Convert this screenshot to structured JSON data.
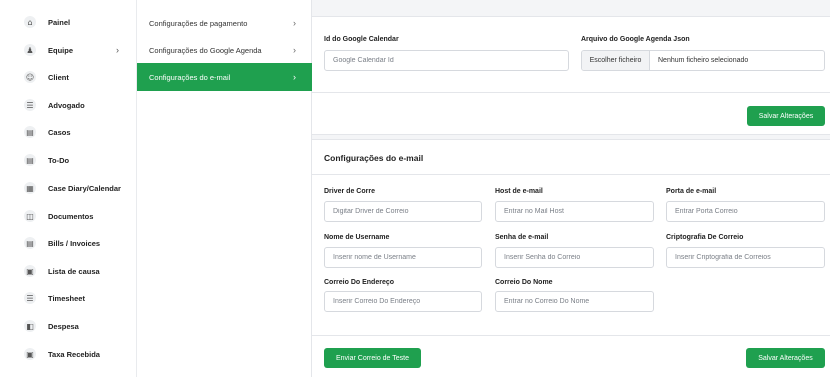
{
  "sidebar": {
    "items": [
      {
        "label": "Painel",
        "icon": "home-icon",
        "glyph": "⌂"
      },
      {
        "label": "Equipe",
        "icon": "team-icon",
        "glyph": "♟",
        "has_chevron": true
      },
      {
        "label": "Client",
        "icon": "client-icon",
        "glyph": "☺"
      },
      {
        "label": "Advogado",
        "icon": "list-icon",
        "glyph": "☰"
      },
      {
        "label": "Casos",
        "icon": "document-icon",
        "glyph": "▤"
      },
      {
        "label": "To-Do",
        "icon": "todo-icon",
        "glyph": "▤"
      },
      {
        "label": "Case Diary/Calendar",
        "icon": "calendar-icon",
        "glyph": "▦"
      },
      {
        "label": "Documentos",
        "icon": "file-icon",
        "glyph": "◫"
      },
      {
        "label": "Bills / Invoices",
        "icon": "invoice-icon",
        "glyph": "▤"
      },
      {
        "label": "Lista de causa",
        "icon": "clipboard-icon",
        "glyph": "▣"
      },
      {
        "label": "Timesheet",
        "icon": "timesheet-icon",
        "glyph": "☰"
      },
      {
        "label": "Despesa",
        "icon": "expense-icon",
        "glyph": "◧"
      },
      {
        "label": "Taxa Recebida",
        "icon": "receipt-icon",
        "glyph": "▣"
      }
    ],
    "chevron": "›"
  },
  "submenu": {
    "items": [
      {
        "label": "Configurações de pagamento",
        "active": false
      },
      {
        "label": "Configurações do Google Agenda",
        "active": false
      },
      {
        "label": "Configurações do e-mail",
        "active": true
      }
    ],
    "chevron": "›"
  },
  "google": {
    "calendar_id_label": "Id do Google Calendar",
    "calendar_id_placeholder": "Google Calendar Id",
    "json_label": "Arquivo do Google Agenda Json",
    "file_button": "Escolher ficheiro",
    "file_status": "Nenhum ficheiro selecionado",
    "save_label": "Salvar Alterações"
  },
  "email": {
    "section_title": "Configurações do e-mail",
    "driver_label": "Driver de Corre",
    "driver_placeholder": "Digitar Driver de Correio",
    "host_label": "Host de e-mail",
    "host_placeholder": "Entrar no Mail Host",
    "port_label": "Porta de e-mail",
    "port_placeholder": "Entrar Porta Correio",
    "username_label": "Nome de Username",
    "username_placeholder": "Inserir nome de Username",
    "password_label": "Senha de e-mail",
    "password_placeholder": "Inserir Senha do Correio",
    "encryption_label": "Criptografia De Correio",
    "encryption_placeholder": "Inserir Criptografia de Correios",
    "address_label": "Correio Do Endereço",
    "address_placeholder": "Inserir Correio Do Endereço",
    "name_label": "Correio Do Nome",
    "name_placeholder": "Entrar no Correio Do Nome",
    "test_label": "Enviar Correio de Teste",
    "save_label": "Salvar Alterações"
  },
  "colors": {
    "accent": "#1fa04f",
    "background": "#f4f5f7"
  }
}
